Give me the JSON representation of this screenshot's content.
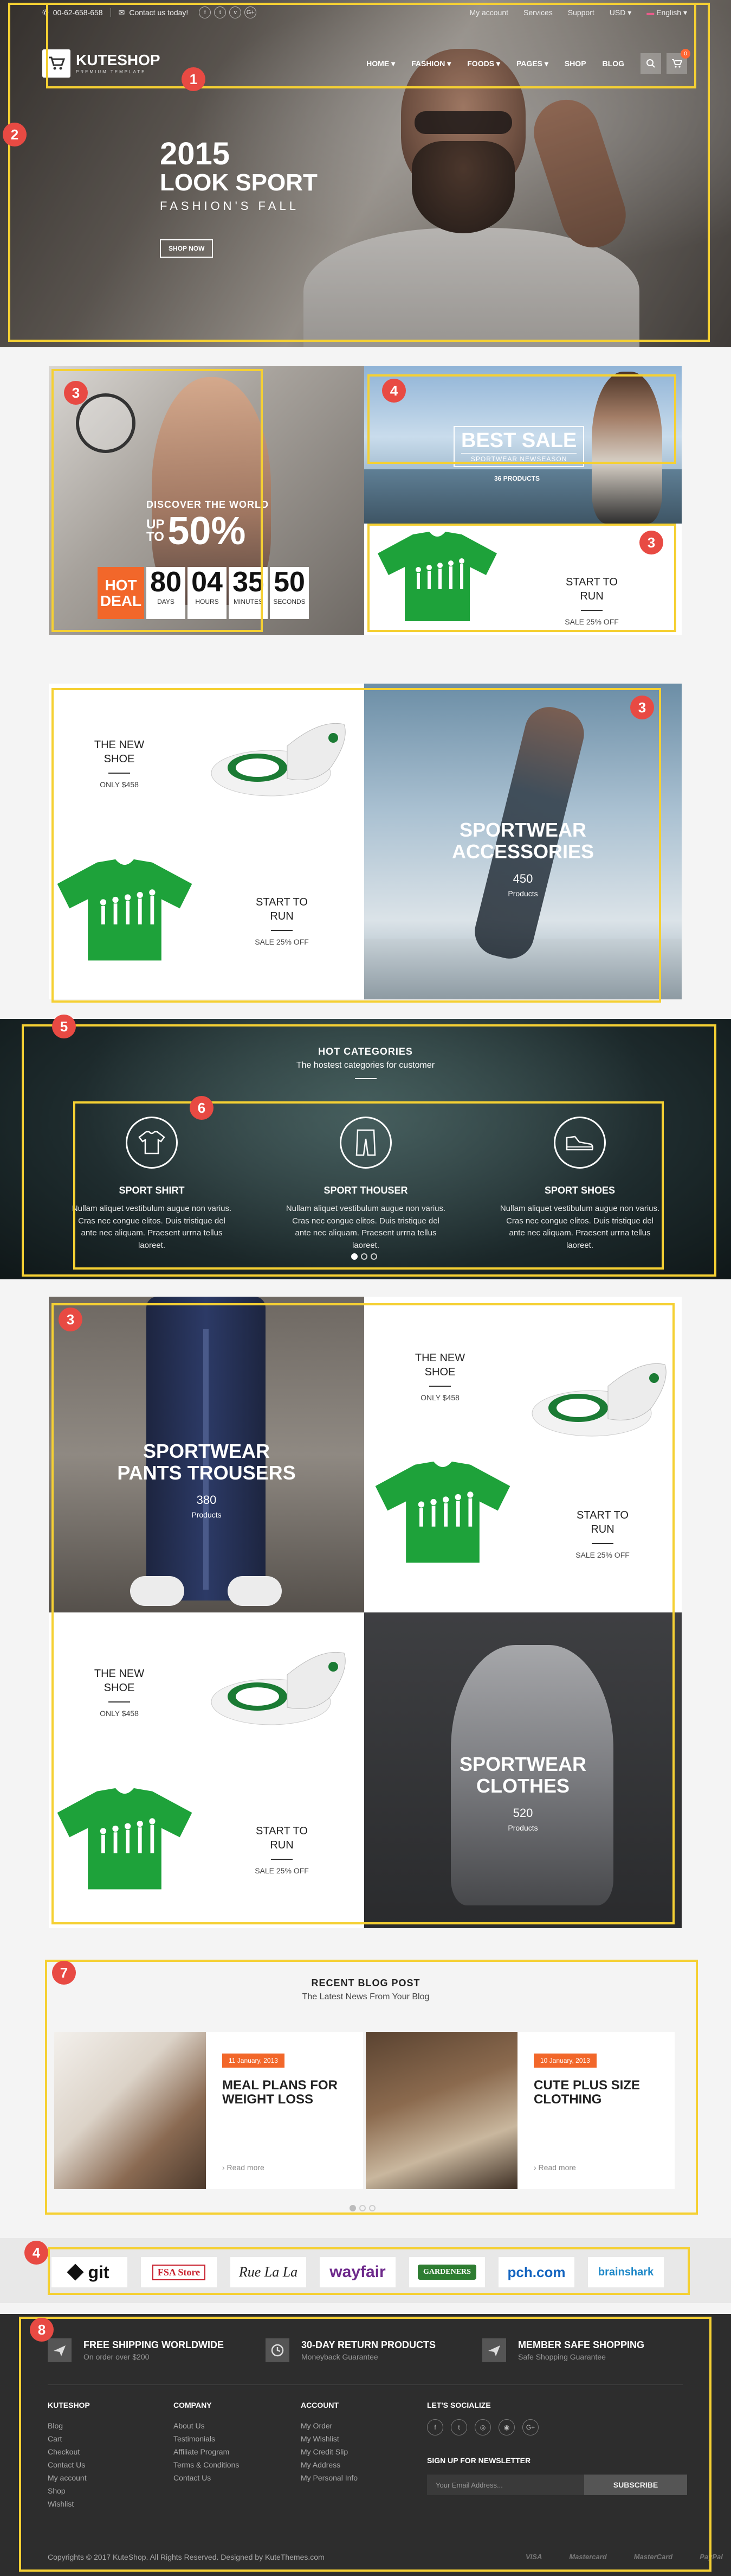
{
  "topbar": {
    "phone": "00-62-658-658",
    "contact": "Contact us today!",
    "social": [
      "f",
      "t",
      "v",
      "G+"
    ],
    "links": [
      "My account",
      "Services",
      "Support"
    ],
    "currency": "USD",
    "language": "English"
  },
  "nav": {
    "brand": "KUTESHOP",
    "tagline": "PREMIUM TEMPLATE",
    "menu": [
      "HOME",
      "FASHION",
      "FOODS",
      "PAGES",
      "SHOP",
      "BLOG"
    ],
    "cart_count": "0"
  },
  "hero": {
    "year": "2015",
    "title": "LOOK SPORT",
    "subtitle": "FASHION'S FALL",
    "button": "SHOP NOW"
  },
  "annotations": [
    "1",
    "2",
    "3",
    "4",
    "3",
    "3",
    "5",
    "6",
    "3",
    "7",
    "4",
    "8"
  ],
  "promos": {
    "tennis": {
      "line1": "DISCOVER THE WORLD",
      "up": "UP",
      "to": "TO",
      "percent": "50%"
    },
    "countdown": {
      "hot": "HOT",
      "deal": "DEAL",
      "cells": [
        {
          "value": "80",
          "label": "DAYS"
        },
        {
          "value": "04",
          "label": "HOURS"
        },
        {
          "value": "35",
          "label": "MINUTES"
        },
        {
          "value": "50",
          "label": "SECONDS"
        }
      ]
    },
    "best_sale": {
      "title": "BEST SALE",
      "sub": "SPORTWEAR NEWSEASON",
      "count": "36 PRODUCTS"
    },
    "start_to_run": {
      "title_a": "START TO",
      "title_b": "RUN",
      "sub": "SALE 25% OFF"
    },
    "new_shoe": {
      "title_a": "THE NEW",
      "title_b": "SHOE",
      "sub": "ONLY $458"
    },
    "accessories": {
      "title_a": "SPORTWEAR",
      "title_b": "ACCESSORIES",
      "count": "450",
      "label": "Products"
    },
    "trousers": {
      "title_a": "SPORTWEAR",
      "title_b": "PANTS TROUSERS",
      "count": "380",
      "label": "Products"
    },
    "clothes": {
      "title_a": "SPORTWEAR",
      "title_b": "CLOTHES",
      "count": "520",
      "label": "Products"
    }
  },
  "hot_categories": {
    "title": "HOT CATEGORIES",
    "subtitle": "The hostest categories for customer",
    "items": [
      {
        "name": "SPORT SHIRT",
        "desc": "Nullam aliquet vestibulum augue non varius. Cras nec congue elitos. Duis tristique del ante nec aliquam. Praesent urrna tellus laoreet."
      },
      {
        "name": "SPORT THOUSER",
        "desc": "Nullam aliquet vestibulum augue non varius. Cras nec congue elitos. Duis tristique del ante nec aliquam. Praesent urrna tellus laoreet."
      },
      {
        "name": "SPORT SHOES",
        "desc": "Nullam aliquet vestibulum augue non varius. Cras nec congue elitos. Duis tristique del ante nec aliquam. Praesent urrna tellus laoreet."
      }
    ]
  },
  "blog": {
    "title": "RECENT BLOG POST",
    "subtitle": "The Latest News From Your Blog",
    "posts": [
      {
        "date": "11 January, 2013",
        "title": "MEAL PLANS FOR WEIGHT LOSS",
        "more": "› Read more"
      },
      {
        "date": "10 January, 2013",
        "title": "CUTE PLUS SIZE CLOTHING",
        "more": "› Read more"
      }
    ]
  },
  "brands": [
    "git",
    "FSA Store",
    "Rue La La",
    "wayfair",
    "GARDENERS",
    "pch.com",
    "brainshark"
  ],
  "footer": {
    "features": [
      {
        "title": "FREE SHIPPING WORLDWIDE",
        "sub": "On order over $200"
      },
      {
        "title": "30-DAY RETURN PRODUCTS",
        "sub": "Moneyback Guarantee"
      },
      {
        "title": "MEMBER SAFE SHOPPING",
        "sub": "Safe Shopping Guarantee"
      }
    ],
    "columns": [
      {
        "heading": "KUTESHOP",
        "links": [
          "Blog",
          "Cart",
          "Checkout",
          "Contact Us",
          "My account",
          "Shop",
          "Wishlist"
        ]
      },
      {
        "heading": "COMPANY",
        "links": [
          "About Us",
          "Testimonials",
          "Affiliate Program",
          "Terms & Conditions",
          "Contact Us"
        ]
      },
      {
        "heading": "ACCOUNT",
        "links": [
          "My Order",
          "My Wishlist",
          "My Credit Slip",
          "My Address",
          "My Personal Info"
        ]
      }
    ],
    "socialize_heading": "LET'S SOCIALIZE",
    "social": [
      "f",
      "t",
      "◎",
      "◉",
      "G+"
    ],
    "newsletter_heading": "SIGN UP FOR NEWSLETTER",
    "email_placeholder": "Your Email Address...",
    "subscribe": "SUBSCRIBE",
    "copyright": "Copyrights © 2017 KuteShop. All Rights Reserved. Designed by KuteThemes.com",
    "payments": [
      "VISA",
      "Mastercard",
      "MasterCard",
      "PayPal"
    ]
  }
}
